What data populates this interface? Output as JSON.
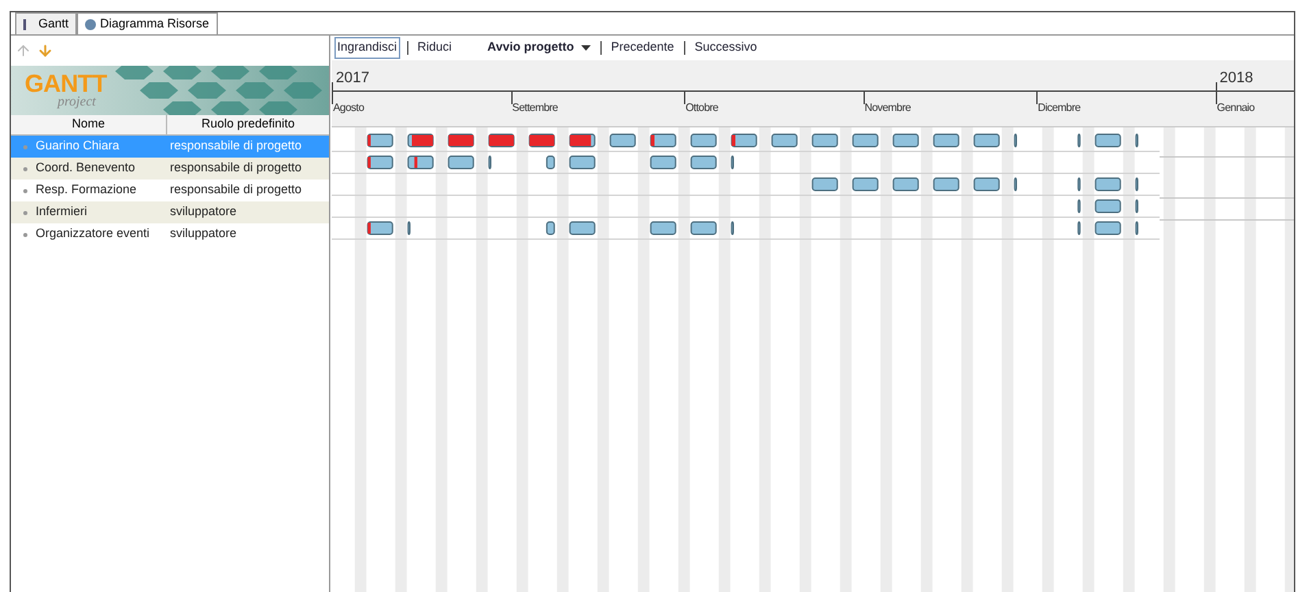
{
  "tabs": [
    {
      "label": "Gantt",
      "selected": false
    },
    {
      "label": "Diagramma Risorse",
      "selected": true
    }
  ],
  "logo": {
    "title": "GANTT",
    "subtitle": "project"
  },
  "columns": [
    "Nome",
    "Ruolo predefinito"
  ],
  "resources": [
    {
      "name": "Guarino Chiara",
      "role": "responsabile di progetto",
      "selected": true
    },
    {
      "name": "Coord. Benevento",
      "role": "responsabile di progetto",
      "selected": false
    },
    {
      "name": "Resp. Formazione",
      "role": "responsabile di progetto",
      "selected": false
    },
    {
      "name": "Infermieri",
      "role": "sviluppatore",
      "selected": false
    },
    {
      "name": "Organizzatore eventi",
      "role": "sviluppatore",
      "selected": false
    }
  ],
  "toolbar": [
    {
      "label": "Ingrandisci",
      "kind": "button",
      "focused": true
    },
    {
      "label": "Riduci",
      "kind": "button",
      "focused": false
    },
    {
      "label": "Avvio progetto",
      "kind": "dropdown",
      "focused": false
    },
    {
      "label": "Precedente",
      "kind": "button",
      "focused": false
    },
    {
      "label": "Successivo",
      "kind": "button",
      "focused": false
    }
  ],
  "timeline": {
    "years": [
      "2017",
      "2018"
    ],
    "months": [
      "Agosto",
      "Settembre",
      "Ottobre",
      "Novembre",
      "Dicembre",
      "Gennaio"
    ]
  }
}
